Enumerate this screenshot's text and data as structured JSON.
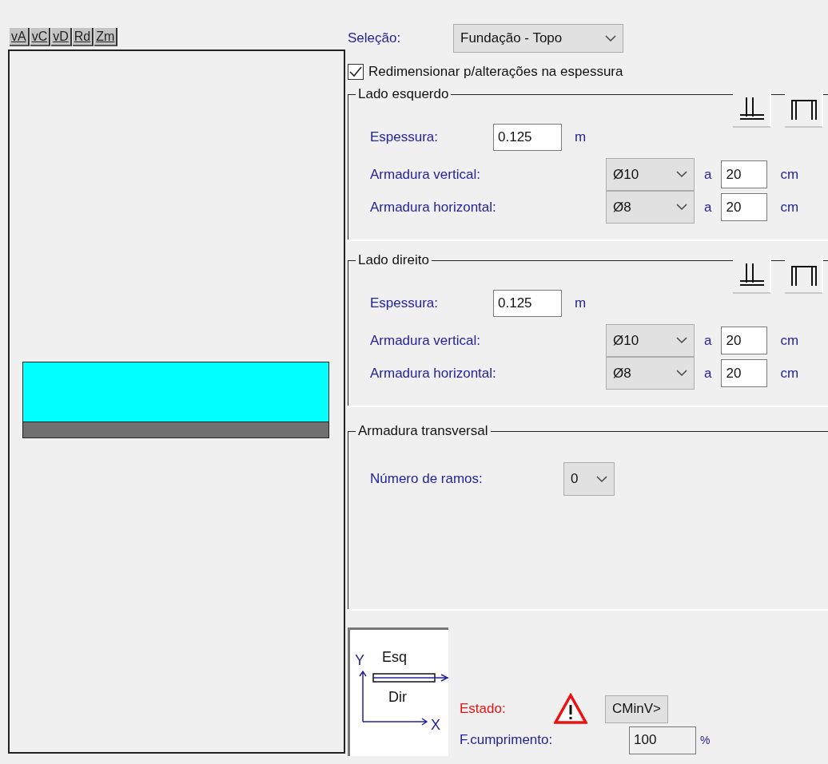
{
  "view_toolbar": [
    "vA",
    "vC",
    "vD",
    "Rd",
    "Zm"
  ],
  "selection": {
    "label": "Seleção:",
    "value": "Fundação - Topo"
  },
  "resize_option": {
    "label": "Redimensionar p/alterações na espessura",
    "checked": true
  },
  "sides": [
    {
      "title": "Lado esquerdo",
      "thickness_label": "Espessura:",
      "thickness": "0.125",
      "thickness_unit": "m",
      "rebars": [
        {
          "label": "Armadura vertical:",
          "diameter": "Ø10",
          "sep": "a",
          "spacing": "20",
          "unit": "cm"
        },
        {
          "label": "Armadura horizontal:",
          "diameter": "Ø8",
          "sep": "a",
          "spacing": "20",
          "unit": "cm"
        }
      ]
    },
    {
      "title": "Lado direito",
      "thickness_label": "Espessura:",
      "thickness": "0.125",
      "thickness_unit": "m",
      "rebars": [
        {
          "label": "Armadura vertical:",
          "diameter": "Ø10",
          "sep": "a",
          "spacing": "20",
          "unit": "cm"
        },
        {
          "label": "Armadura horizontal:",
          "diameter": "Ø8",
          "sep": "a",
          "spacing": "20",
          "unit": "cm"
        }
      ]
    }
  ],
  "transverse": {
    "title": "Armadura transversal",
    "label": "Número de ramos:",
    "value": "0"
  },
  "orientation_diagram": {
    "y_axis": "Y",
    "top": "Esq",
    "bottom": "Dir",
    "x_axis": "X"
  },
  "status": {
    "label": "Estado:",
    "button": "CMinV>",
    "compliance_label": "F.cumprimento:",
    "compliance": "100",
    "unit": "%"
  }
}
